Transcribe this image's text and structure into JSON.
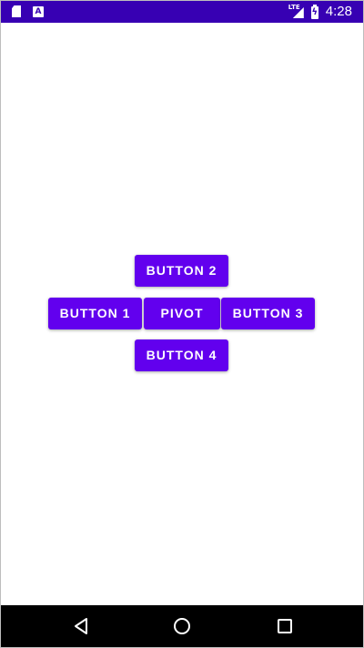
{
  "status_bar": {
    "time": "4:28",
    "network": "LTE",
    "icons": [
      "sd-card-icon",
      "a-notification-icon",
      "lte-signal-icon",
      "battery-charging-icon"
    ],
    "color": "#3700b3"
  },
  "buttons": {
    "button2": "BUTTON 2",
    "button1": "BUTTON 1",
    "pivot": "PIVOT",
    "button3": "BUTTON 3",
    "button4": "BUTTON 4"
  },
  "theme": {
    "button_color": "#6200ee",
    "button_text_color": "#ffffff",
    "background": "#ffffff",
    "nav_bar_color": "#000000"
  },
  "nav_bar": {
    "icons": [
      "back-icon",
      "home-icon",
      "recents-icon"
    ]
  }
}
